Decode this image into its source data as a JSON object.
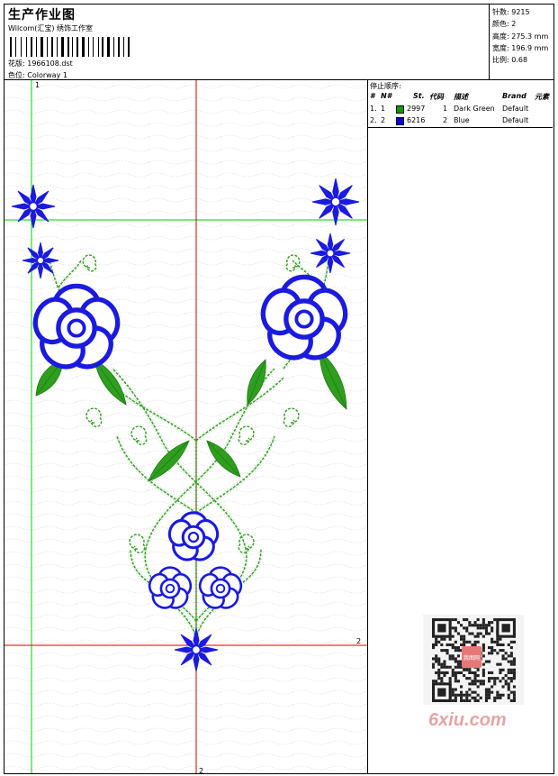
{
  "header": {
    "title": "生产作业图",
    "subtitle": "Wilcom(汇宝) 绣饰工作室",
    "design_label": "花版: 1966108.dst",
    "colorway_label": "色位: Colorway 1"
  },
  "stats": {
    "stitches": "针数: 9215",
    "colors": "颜色: 2",
    "height": "高度: 275.3 mm",
    "width": "宽度: 196.9 mm",
    "scale": "比例: 0.68"
  },
  "stop_sequence": {
    "title": "停止顺序:",
    "headers": {
      "index": "#",
      "number": "N#",
      "stitch": "St.",
      "code": "代码",
      "description": "描述",
      "brand": "Brand",
      "element": "元素"
    },
    "rows": [
      {
        "index": "1.",
        "number": "1",
        "color": "#00a000",
        "stitch": "2997",
        "code": "1",
        "description": "Dark Green",
        "brand": "Default"
      },
      {
        "index": "2.",
        "number": "2",
        "color": "#0000ee",
        "stitch": "6216",
        "code": "2",
        "description": "Blue",
        "brand": "Default"
      }
    ]
  },
  "canvas": {
    "marker_1": "1",
    "marker_2_right": "2",
    "marker_2_bottom": "2",
    "thread_green": "#2e9e1e",
    "thread_blue": "#1a1ae0",
    "guide_green": "#00cc00",
    "guide_red": "#d40000"
  },
  "watermark": {
    "text": "6xiu.com",
    "qr_center": "我图网"
  },
  "icons": {
    "barcode": "barcode-icon",
    "qr": "qr-code-icon"
  }
}
